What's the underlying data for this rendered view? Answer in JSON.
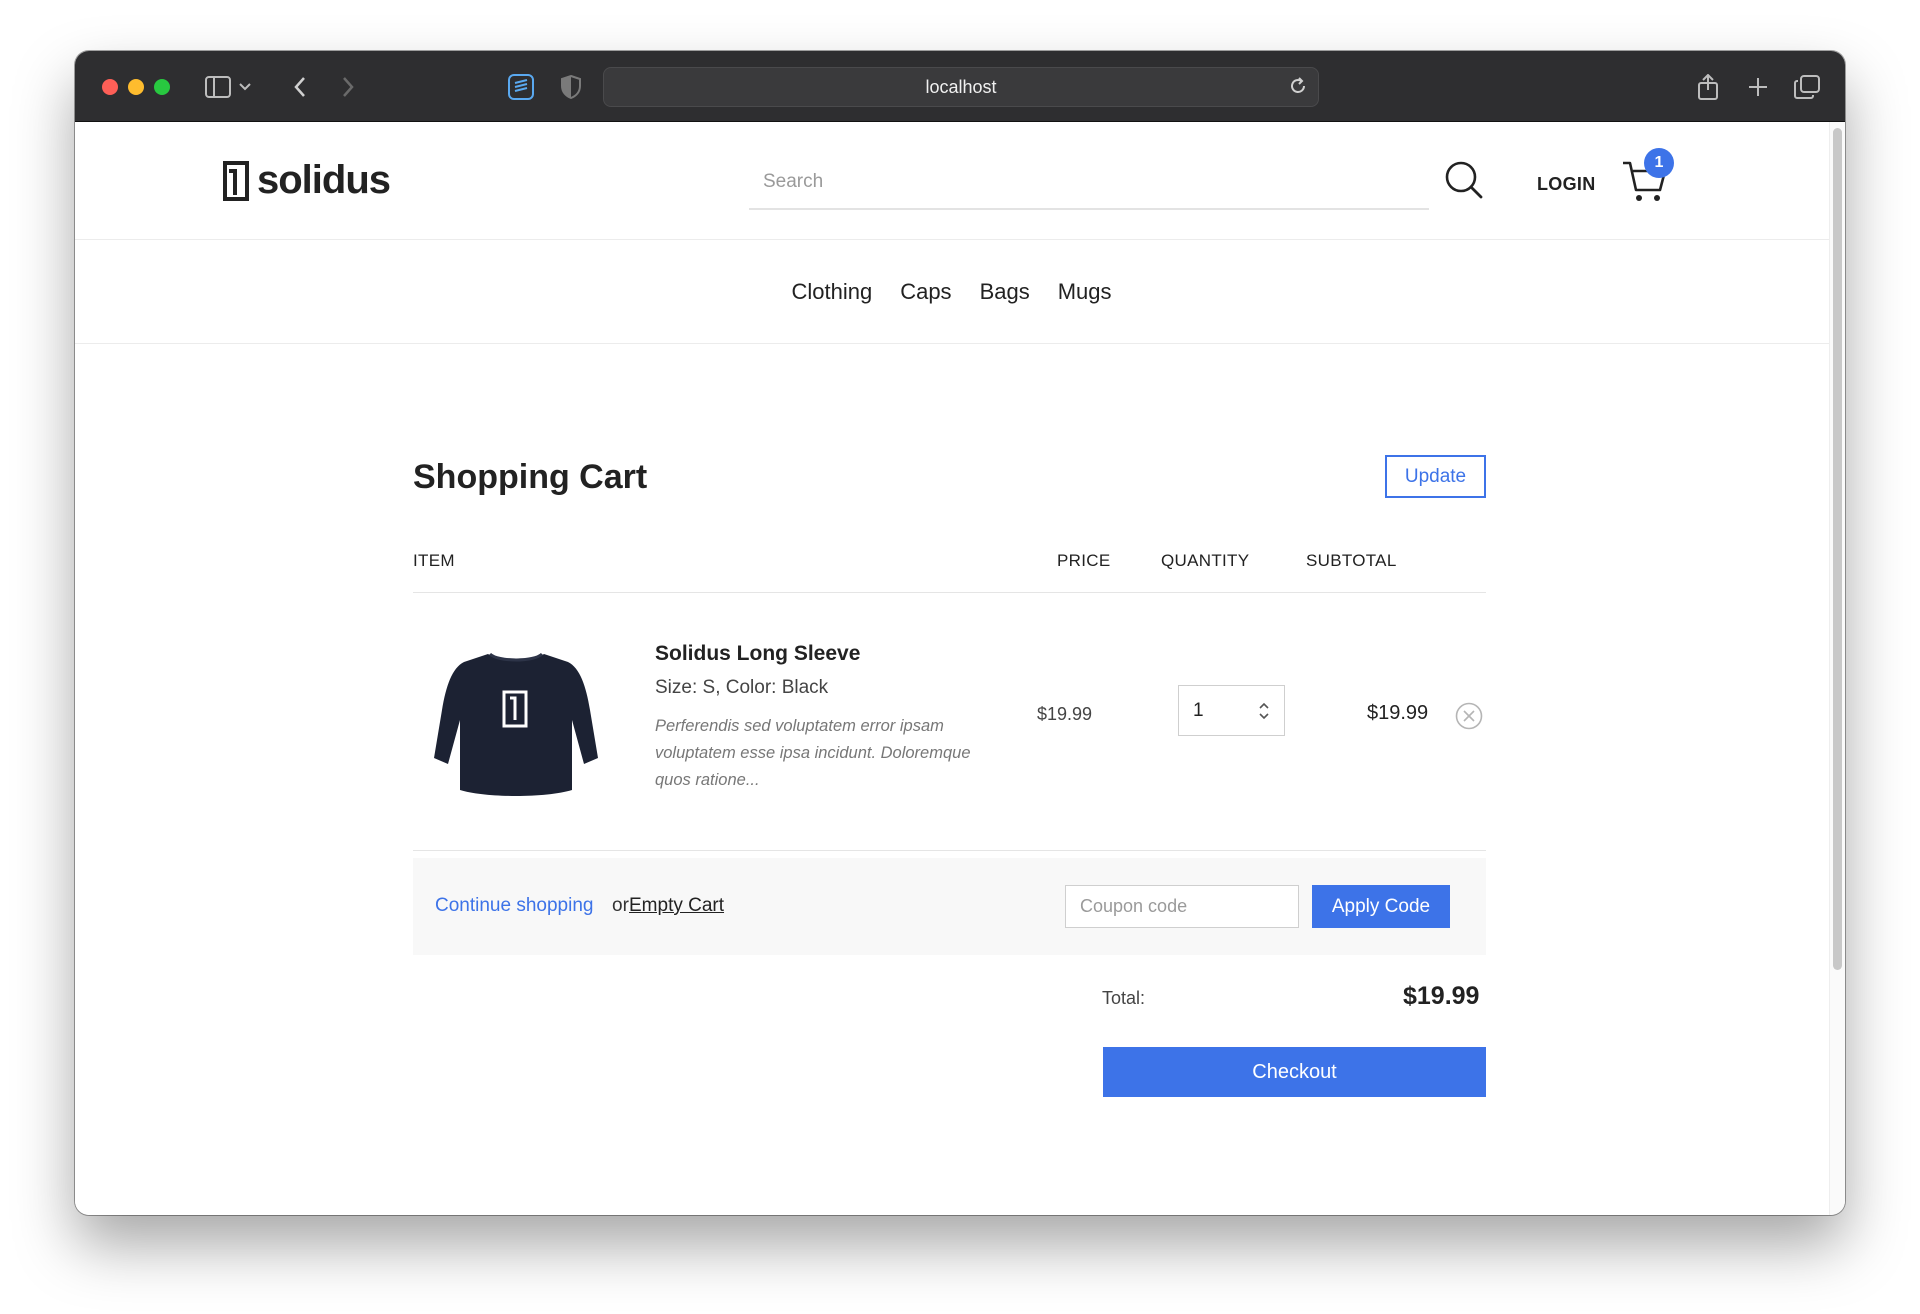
{
  "browser": {
    "url": "localhost",
    "icons": [
      "sidebar-icon",
      "chevron-down-icon",
      "back-icon",
      "forward-icon",
      "tabs-extension-icon",
      "privacy-shield-icon",
      "reload-icon",
      "share-icon",
      "new-tab-icon",
      "tab-overview-icon"
    ]
  },
  "header": {
    "logo_text": "solidus",
    "search_placeholder": "Search",
    "login_label": "LOGIN",
    "cart_count": "1"
  },
  "nav": {
    "items": [
      {
        "label": "Clothing"
      },
      {
        "label": "Caps"
      },
      {
        "label": "Bags"
      },
      {
        "label": "Mugs"
      }
    ]
  },
  "cart": {
    "title": "Shopping Cart",
    "update_label": "Update",
    "columns": {
      "item": "ITEM",
      "price": "PRICE",
      "quantity": "QUANTITY",
      "subtotal": "SUBTOTAL"
    },
    "line_items": [
      {
        "name": "Solidus Long Sleeve",
        "variant": "Size: S, Color: Black",
        "description": "Perferendis sed voluptatem error ipsam voluptatem esse ipsa incidunt. Doloremque quos ratione...",
        "price": "$19.99",
        "quantity": "1",
        "subtotal": "$19.99"
      }
    ],
    "continue_label": "Continue shopping",
    "or_label": "or",
    "empty_label": "Empty Cart",
    "coupon_placeholder": "Coupon code",
    "apply_label": "Apply Code",
    "total_label": "Total:",
    "total_value": "$19.99",
    "checkout_label": "Checkout"
  },
  "colors": {
    "accent": "#3d73e8",
    "titlebar": "#2e2e30"
  }
}
